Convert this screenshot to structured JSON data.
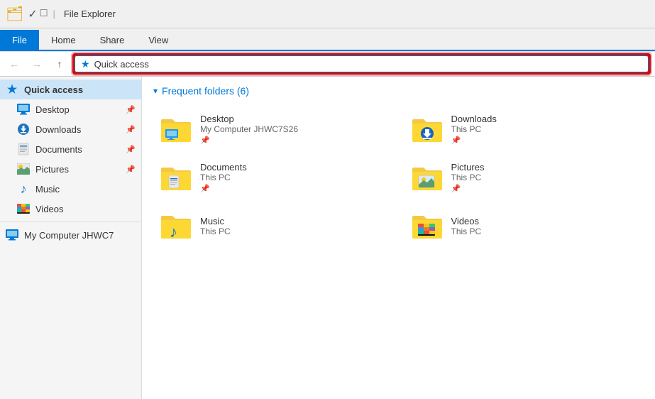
{
  "titleBar": {
    "icon": "🗂",
    "title": "File Explorer",
    "separator": "|",
    "quicktools": [
      "✓",
      "□"
    ]
  },
  "ribbon": {
    "tabs": [
      {
        "label": "File",
        "active": true
      },
      {
        "label": "Home",
        "active": false
      },
      {
        "label": "Share",
        "active": false
      },
      {
        "label": "View",
        "active": false
      }
    ]
  },
  "addressBar": {
    "back_label": "←",
    "forward_label": "→",
    "up_label": "↑",
    "address": "Quick access",
    "star": "★"
  },
  "sidebar": {
    "sections": [
      {
        "label": "Quick access",
        "icon": "star",
        "active": true,
        "items": [
          {
            "label": "Desktop",
            "icon": "desktop",
            "pinned": true
          },
          {
            "label": "Downloads",
            "icon": "downloads",
            "pinned": true
          },
          {
            "label": "Documents",
            "icon": "documents",
            "pinned": true
          },
          {
            "label": "Pictures",
            "icon": "pictures",
            "pinned": true
          },
          {
            "label": "Music",
            "icon": "music",
            "pinned": false
          },
          {
            "label": "Videos",
            "icon": "videos",
            "pinned": false
          }
        ]
      },
      {
        "label": "My Computer JHWC7",
        "icon": "computer",
        "items": []
      }
    ]
  },
  "content": {
    "sectionTitle": "Frequent folders (6)",
    "folders": [
      {
        "name": "Desktop",
        "sub": "My Computer JHWC7S26",
        "pinned": true,
        "type": "desktop"
      },
      {
        "name": "Downloads",
        "sub": "This PC",
        "pinned": true,
        "type": "downloads"
      },
      {
        "name": "Documents",
        "sub": "This PC",
        "pinned": true,
        "type": "documents"
      },
      {
        "name": "Pictures",
        "sub": "This PC",
        "pinned": true,
        "type": "pictures"
      },
      {
        "name": "Music",
        "sub": "This PC",
        "pinned": false,
        "type": "music"
      },
      {
        "name": "Videos",
        "sub": "This PC",
        "pinned": false,
        "type": "videos"
      }
    ]
  }
}
